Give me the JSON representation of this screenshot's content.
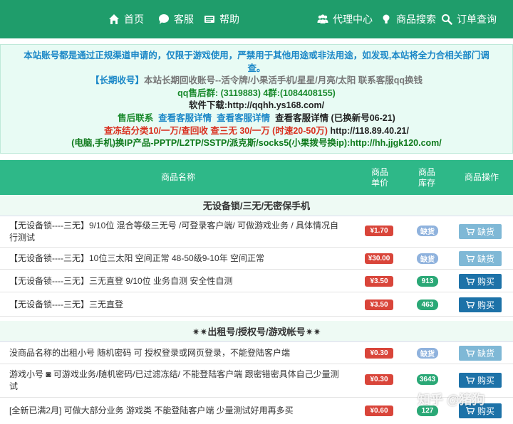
{
  "nav": {
    "home": "首页",
    "service": "客服",
    "help": "帮助",
    "agent": "代理中心",
    "product_search": "商品搜索",
    "order_search": "订单查询"
  },
  "notice": {
    "line1a": "本站账号都是通过正规渠道申请的，仅限于游戏使用，严禁用于其他用途或非法用途，如发现,本站将全力合相关部门调",
    "line1b": "查。",
    "line2_label": "【长期收号】",
    "line2_text": "本站长期回收账号--活令牌/小果活手机/星星/月亮/太阳  联系客服qq换钱",
    "line3": "qq售后群: (3119883) 4群:(1084408155)",
    "line4": "软件下载:http://qqhh.ys168.com/",
    "line5_label": "售后联系",
    "line5_link1": "查看客服详情",
    "line5_link2": "查看客服详情",
    "line5_text": "查看客服详情 (已换新号06-21)",
    "line6_red": "查冻结分类10/一万/查回收 查三无 30/一万 (时速20-50万)",
    "line6_url": "http://118.89.40.21/",
    "line7": "(电脑,手机)换IP产品-PPTP/L2TP/SSTP/派克斯/socks5(小果拨号换ip):http://hh.jjgk120.com/"
  },
  "table": {
    "headers": {
      "name": "商品名称",
      "price": "商品单价",
      "stock": "商品库存",
      "op": "商品操作"
    },
    "categories": [
      "无设备锁/三无/无密保手机",
      "✷✷出租号/授权号/游戏帐号✷✷"
    ],
    "rows": [
      {
        "name": "【无设备锁----三无】9/10位 混合等级三无号 /可登录客户端/ 可做游戏业务 / 具体情况自行测试",
        "price": "¥1.70",
        "stock": "缺货",
        "action": "缺货"
      },
      {
        "name": "【无设备锁----三无】10位三太阳 空间正常 48-50级9-10年 空间正常",
        "price": "¥30.00",
        "stock": "缺货",
        "action": "缺货"
      },
      {
        "name": "【无设备锁----三无】三无直登 9/10位 业务自测 安全性自测",
        "price": "¥3.50",
        "stock": "913",
        "action": "购买"
      },
      {
        "name": "【无设备锁----三无】三无直登",
        "price": "¥3.50",
        "stock": "463",
        "action": "购买"
      },
      {
        "name": "没商品名称的出租小号 随机密码 可 授权登录或网页登录，不能登陆客户端",
        "price": "¥0.30",
        "stock": "缺货",
        "action": "缺货"
      },
      {
        "name": "游戏小号 ◙ 可游戏业务/随机密码/已过滤冻结/ 不能登陆客户端 跟密错密具体自己少量测试",
        "price": "¥0.30",
        "stock": "3643",
        "action": "购买"
      },
      {
        "name": "[全新已满2月] 可做大部分业务 游戏类 不能登陆客户端 少量测试好用再多买",
        "price": "¥0.60",
        "stock": "127",
        "action": "购买"
      }
    ]
  },
  "watermark": "知乎 @猪狗"
}
